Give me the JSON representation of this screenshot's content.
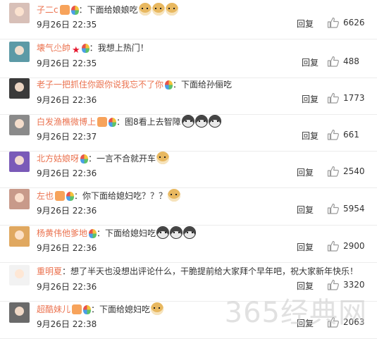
{
  "comments": [
    {
      "username": "子二c",
      "badges": [
        "v",
        "bulb"
      ],
      "text": "下面给娘娘吃",
      "emojis": [
        "doge",
        "doge",
        "doge"
      ],
      "date": "9月26日 22:35",
      "reply_label": "回复",
      "likes": "6626",
      "avatar_color": "#d8c0b8"
    },
    {
      "username": "壊气尐帥",
      "badges": [
        "star",
        "bulb"
      ],
      "text": "我想上热门！",
      "emojis": [],
      "date": "9月26日 22:35",
      "reply_label": "回复",
      "likes": "488",
      "avatar_color": "#5c9aa6"
    },
    {
      "username": "老子一把抓住你跟你说我忘不了你",
      "badges": [
        "bulb"
      ],
      "text": "下面给孙俪吃",
      "emojis": [],
      "date": "9月26日 22:36",
      "reply_label": "回复",
      "likes": "1773",
      "avatar_color": "#3a3a3a"
    },
    {
      "username": "白发渔樵微博上",
      "badges": [
        "v",
        "bulb"
      ],
      "text": "图8看上去智障",
      "emojis": [
        "husky",
        "husky",
        "husky"
      ],
      "date": "9月26日 22:37",
      "reply_label": "回复",
      "likes": "661",
      "avatar_color": "#8a8a8a"
    },
    {
      "username": "北方姑娘呀",
      "badges": [
        "bulb"
      ],
      "text": "一言不合就开车",
      "emojis": [
        "doge"
      ],
      "date": "9月26日 22:36",
      "reply_label": "回复",
      "likes": "2540",
      "avatar_color": "#7a5ab8"
    },
    {
      "username": "左也",
      "badges": [
        "v",
        "bulb"
      ],
      "text": "你下面给媳妇吃？？？",
      "emojis": [
        "doge"
      ],
      "date": "9月26日 22:36",
      "reply_label": "回复",
      "likes": "5954",
      "avatar_color": "#c89a8a"
    },
    {
      "username": "杨黄伟他爹地",
      "badges": [
        "bulb"
      ],
      "text": "下面给媳妇吃",
      "emojis": [
        "husky",
        "husky",
        "husky"
      ],
      "date": "9月26日 22:36",
      "reply_label": "回复",
      "likes": "2900",
      "avatar_color": "#e0a860"
    },
    {
      "username": "重明夏",
      "badges": [],
      "text": "想了半天也没想出评论什么，干脆提前给大家拜个早年吧，祝大家新年快乐！",
      "emojis": [],
      "date": "9月26日 22:36",
      "reply_label": "回复",
      "likes": "3320",
      "avatar_color": "#f2f2f2"
    },
    {
      "username": "超酷妹儿",
      "badges": [
        "v",
        "bulb"
      ],
      "text": "下面给媳妇吃",
      "emojis": [
        "doge"
      ],
      "date": "9月26日 22:38",
      "reply_label": "回复",
      "likes": "2063",
      "avatar_color": "#6a6a6a"
    }
  ],
  "watermark": "365经典网"
}
